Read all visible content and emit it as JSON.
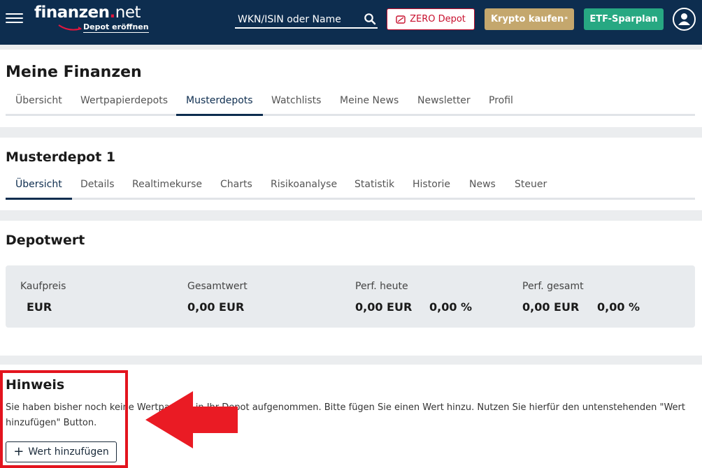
{
  "header": {
    "logo": {
      "name": "finanzen",
      "dot": ".",
      "suffix": "net",
      "tagline": "Depot eröffnen"
    },
    "search": {
      "placeholder": "WKN/ISIN oder Name",
      "value": ""
    },
    "buttons": {
      "zero_depot": "ZERO Depot",
      "krypto": "Krypto kaufen",
      "krypto_sup": "*",
      "etf": "ETF-Sparplan"
    },
    "icons": [
      "menu-icon",
      "search-icon",
      "zero-depot-icon",
      "user-icon"
    ]
  },
  "meine_finanzen": {
    "title": "Meine Finanzen",
    "tabs": [
      {
        "label": "Übersicht",
        "active": false
      },
      {
        "label": "Wertpapierdepots",
        "active": false
      },
      {
        "label": "Musterdepots",
        "active": true
      },
      {
        "label": "Watchlists",
        "active": false
      },
      {
        "label": "Meine News",
        "active": false
      },
      {
        "label": "Newsletter",
        "active": false
      },
      {
        "label": "Profil",
        "active": false
      }
    ]
  },
  "musterdepot": {
    "title": "Musterdepot 1",
    "tabs": [
      {
        "label": "Übersicht",
        "active": true
      },
      {
        "label": "Details",
        "active": false
      },
      {
        "label": "Realtimekurse",
        "active": false
      },
      {
        "label": "Charts",
        "active": false
      },
      {
        "label": "Risikoanalyse",
        "active": false
      },
      {
        "label": "Statistik",
        "active": false
      },
      {
        "label": "Historie",
        "active": false
      },
      {
        "label": "News",
        "active": false
      },
      {
        "label": "Steuer",
        "active": false
      }
    ]
  },
  "depotwert": {
    "title": "Depotwert",
    "kaufpreis": {
      "label": "Kaufpreis",
      "value": "EUR"
    },
    "gesamtwert": {
      "label": "Gesamtwert",
      "value": "0,00 EUR"
    },
    "perf_heute": {
      "label": "Perf. heute",
      "value": "0,00 EUR",
      "percent": "0,00 %"
    },
    "perf_gesamt": {
      "label": "Perf. gesamt",
      "value": "0,00 EUR",
      "percent": "0,00 %"
    }
  },
  "hinweis": {
    "title": "Hinweis",
    "text": "Sie haben bisher noch keine Wertpapiere in Ihr Depot aufgenommen. Bitte fügen Sie einen Wert hinzu. Nutzen Sie hierfür den untenstehenden \"Wert hinzufügen\" Button.",
    "button_plus": "+",
    "button_label": "Wert hinzufügen"
  },
  "colors": {
    "header_bg": "#0d2d4f",
    "zero_red": "#c8102e",
    "krypto_gold": "#c4a76d",
    "etf_green": "#27a882",
    "annotation_red": "#e3141e"
  }
}
